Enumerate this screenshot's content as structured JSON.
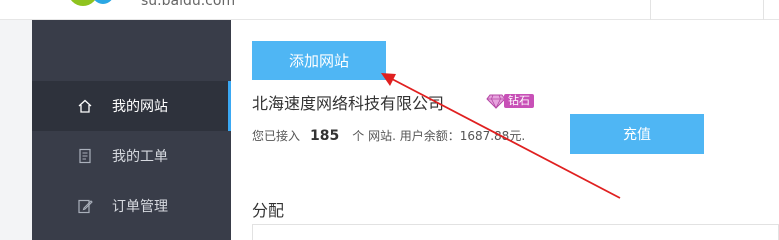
{
  "header": {
    "site_url": "su.baidu.com"
  },
  "sidebar": {
    "items": [
      {
        "label": "我的网站",
        "icon": "home-icon",
        "active": true
      },
      {
        "label": "我的工单",
        "icon": "ticket-icon",
        "active": false
      },
      {
        "label": "订单管理",
        "icon": "edit-icon",
        "active": false
      }
    ]
  },
  "main": {
    "add_site_label": "添加网站",
    "company_name": "北海速度网络科技有限公司",
    "badge": {
      "text": "钻石",
      "icon": "diamond-icon"
    },
    "account": {
      "prefix": "您已接入",
      "site_count": "185",
      "suffix": "个 网站. 用户余额：1687.88元."
    },
    "recharge_label": "充值",
    "section_title": "分配"
  },
  "colors": {
    "sidebar_bg": "#393d49",
    "accent": "#4fb6f4",
    "annotation": "#e02020",
    "badge": "#c850b7"
  }
}
